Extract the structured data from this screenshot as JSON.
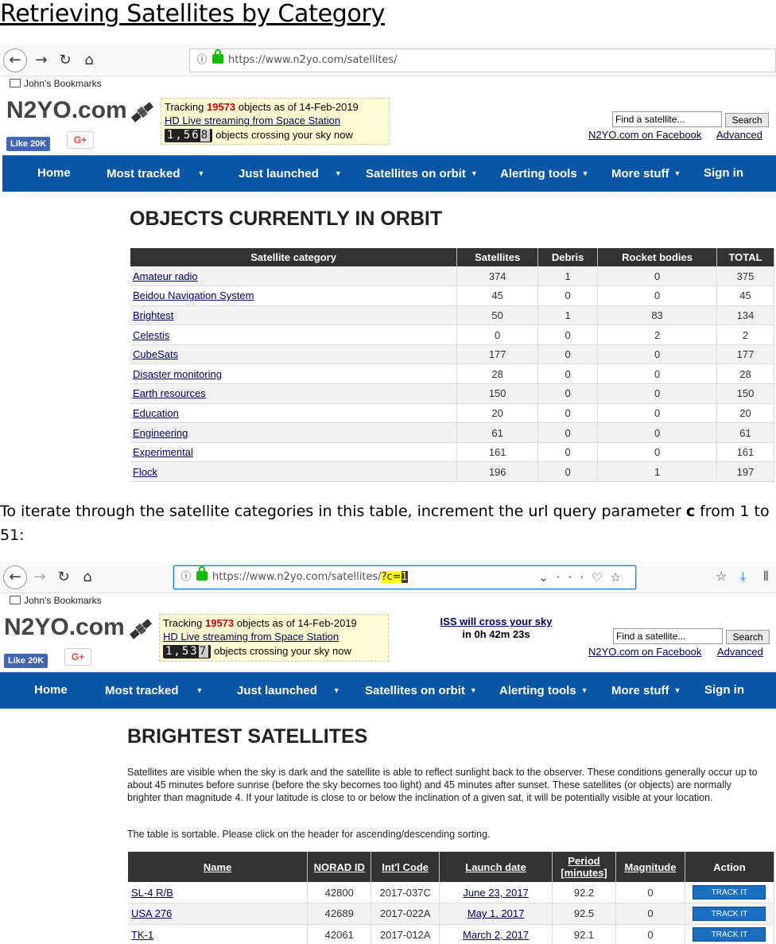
{
  "doc": {
    "heading": "Retrieving Satellites by Category",
    "text_before": "To iterate through the satellite categories in this table, increment the url query parameter ",
    "text_param": "c",
    "text_after": " from 1 to 51:"
  },
  "shot1": {
    "url": "https://www.n2yo.com/satellites/",
    "bookmarks_label": "John's Bookmarks",
    "logo": "N2YO.com",
    "tracking_prefix": "Tracking ",
    "tracking_count": "19573",
    "tracking_suffix": " objects as of 14-Feb-2019",
    "hd_link": "HD Live streaming from Space Station",
    "crossing_digits": "1,56",
    "crossing_last": "8",
    "crossing_text": "objects crossing your sky now",
    "like_label": "Like 20K",
    "gplus_label": "G+",
    "search_value": "Find a satellite...",
    "search_button": "Search",
    "facebook_link": "N2YO.com on Facebook",
    "advanced_link": "Advanced",
    "menu": [
      "Home",
      "Most tracked",
      "Just launched",
      "Satellites on orbit",
      "Alerting tools",
      "More stuff",
      "Sign in"
    ],
    "title": "OBJECTS CURRENTLY IN ORBIT",
    "columns": [
      "Satellite category",
      "Satellites",
      "Debris",
      "Rocket bodies",
      "TOTAL"
    ],
    "rows": [
      [
        "Amateur radio",
        "374",
        "1",
        "0",
        "375"
      ],
      [
        "Beidou Navigation System",
        "45",
        "0",
        "0",
        "45"
      ],
      [
        "Brightest",
        "50",
        "1",
        "83",
        "134"
      ],
      [
        "Celestis",
        "0",
        "0",
        "2",
        "2"
      ],
      [
        "CubeSats",
        "177",
        "0",
        "0",
        "177"
      ],
      [
        "Disaster monitoring",
        "28",
        "0",
        "0",
        "28"
      ],
      [
        "Earth resources",
        "150",
        "0",
        "0",
        "150"
      ],
      [
        "Education",
        "20",
        "0",
        "0",
        "20"
      ],
      [
        "Engineering",
        "61",
        "0",
        "0",
        "61"
      ],
      [
        "Experimental",
        "161",
        "0",
        "0",
        "161"
      ],
      [
        "Flock",
        "196",
        "0",
        "1",
        "197"
      ]
    ]
  },
  "shot2": {
    "url_base": "https://www.n2yo.com/satellites/",
    "url_query": "?c=",
    "url_cursor": "1",
    "bookmarks_label": "John's Bookmarks",
    "logo": "N2YO.com",
    "tracking_prefix": "Tracking ",
    "tracking_count": "19573",
    "tracking_suffix": " objects as of 14-Feb-2019",
    "hd_link": "HD Live streaming from Space Station",
    "crossing_digits": "1,53",
    "crossing_last": "7",
    "crossing_text": "objects crossing your sky now",
    "iss_link": "ISS will cross your sky",
    "iss_time": "in 0h 42m 23s",
    "like_label": "Like 20K",
    "gplus_label": "G+",
    "search_value": "Find a satellite...",
    "search_button": "Search",
    "facebook_link": "N2YO.com on Facebook",
    "advanced_link": "Advanced",
    "menu": [
      "Home",
      "Most tracked",
      "Just launched",
      "Satellites on orbit",
      "Alerting tools",
      "More stuff",
      "Sign in"
    ],
    "title": "BRIGHTEST SATELLITES",
    "description": "Satellites are visible when the sky is dark and the satellite is able to reflect sunlight back to the observer. These conditions generally occur up to about 45 minutes before sunrise (before the sky becomes too light) and 45 minutes after sunset. These satellites (or objects) are normally brighter than magnitude 4. If your latitude is close to or below the inclination of a given sat, it will be potentially visible at your location.",
    "sortable_note": "The table is sortable. Please click on the header for ascending/descending sorting.",
    "columns": [
      "Name",
      "NORAD ID",
      "Int'l Code",
      "Launch date",
      "Period [minutes]",
      "Magnitude",
      "Action"
    ],
    "rows": [
      [
        "SL-4 R/B",
        "42800",
        "2017-037C",
        "June 23, 2017",
        "92.2",
        "0",
        "TRACK IT"
      ],
      [
        "USA 276",
        "42689",
        "2017-022A",
        "May 1, 2017",
        "92.5",
        "0",
        "TRACK IT"
      ],
      [
        "TK-1",
        "42061",
        "2017-012A",
        "March 2, 2017",
        "92.1",
        "0",
        "TRACK IT"
      ]
    ]
  },
  "icons": {
    "back": "back-arrow-icon",
    "forward": "forward-arrow-icon",
    "reload": "reload-icon",
    "home": "home-icon",
    "info": "info-icon",
    "lock": "lock-icon",
    "folder": "folder-icon",
    "satellite": "satellite-logo-icon"
  },
  "colors": {
    "menu_bg": "#0a56a6",
    "header_bg": "#333333",
    "link": "#000066",
    "tracking_count": "#cc0000",
    "track_button": "#1a6ec2"
  }
}
